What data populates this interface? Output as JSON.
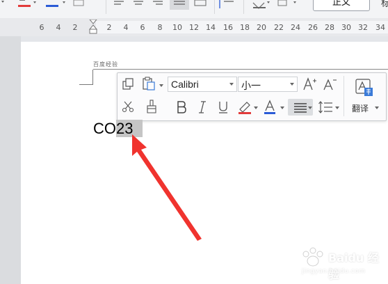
{
  "ribbon": {
    "style_normal_label": "正文",
    "style_next_label": "标"
  },
  "ruler": {
    "ticks": [
      "6",
      "4",
      "2",
      "2",
      "4",
      "6",
      "8",
      "10",
      "12",
      "14",
      "16",
      "18",
      "20",
      "22",
      "24",
      "26",
      "28",
      "30",
      "32",
      "34"
    ]
  },
  "header": {
    "label": "百度经验"
  },
  "mini_toolbar": {
    "font_name": "Calibri",
    "font_size": "小一",
    "translate_label": "翻译",
    "colors": {
      "highlight": "#e23b3b",
      "font_color": "#2b5bd6",
      "accent": "#3b7bd8"
    }
  },
  "document": {
    "text_plain": "CO",
    "text_selected": "23"
  },
  "annotation": {
    "arrow_color": "#f0332e"
  },
  "watermark": {
    "title": "Baidu 经验",
    "url": "jingyan.baidu.com"
  }
}
